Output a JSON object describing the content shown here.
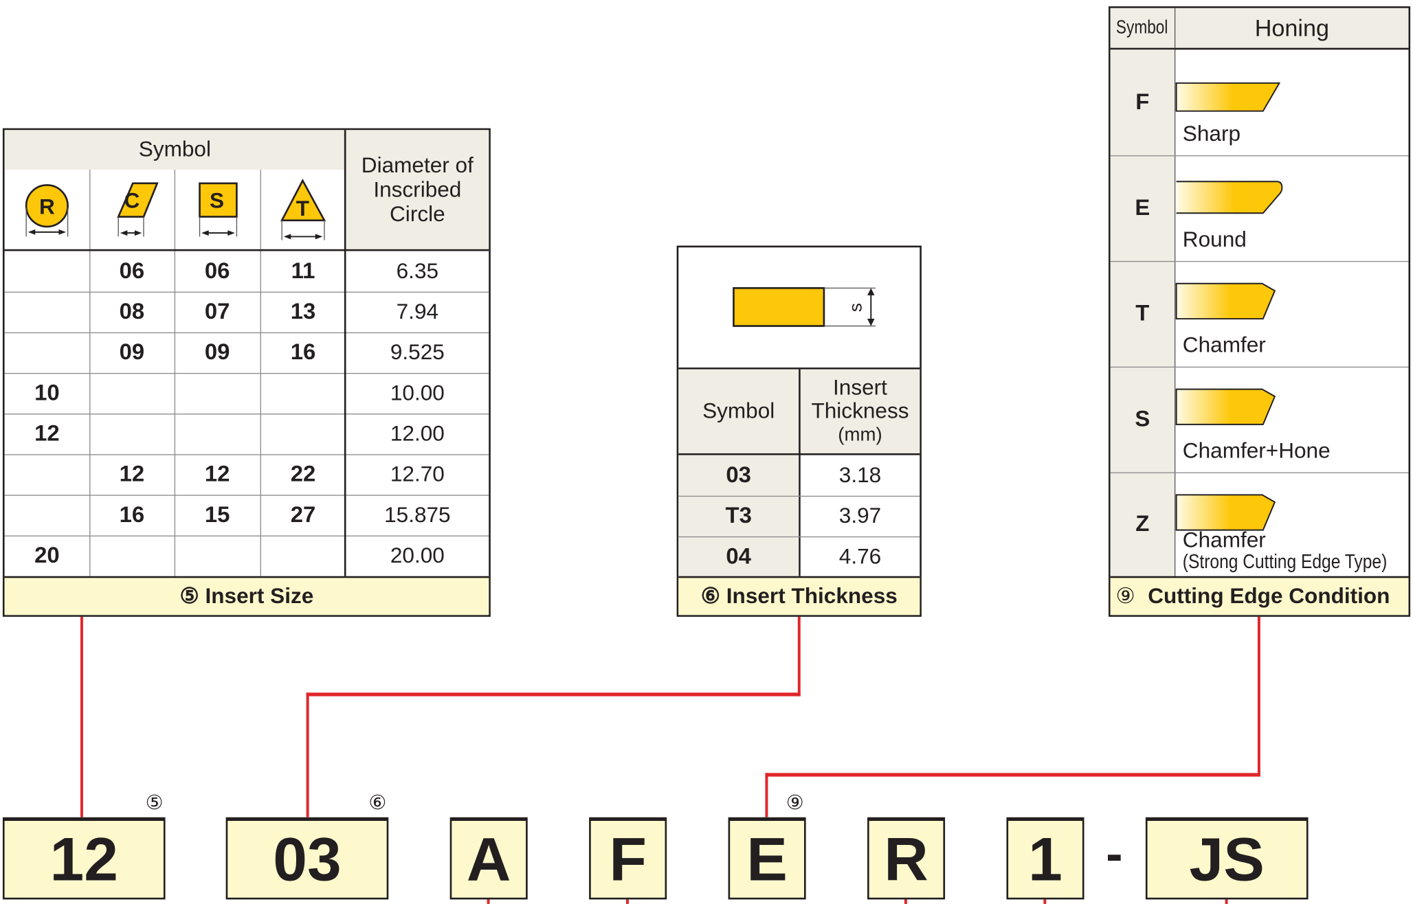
{
  "insert_size": {
    "symbol_header": "Symbol",
    "diameter_header": "Diameter of Inscribed Circle",
    "shapes": [
      {
        "letter": "R",
        "icon": "round-insert-icon"
      },
      {
        "letter": "C",
        "icon": "rhombic-insert-icon"
      },
      {
        "letter": "S",
        "icon": "square-insert-icon"
      },
      {
        "letter": "T",
        "icon": "triangle-insert-icon"
      }
    ],
    "rows": [
      [
        "",
        "06",
        "06",
        "11",
        "6.35"
      ],
      [
        "",
        "08",
        "07",
        "13",
        "7.94"
      ],
      [
        "",
        "09",
        "09",
        "16",
        "9.525"
      ],
      [
        "10",
        "",
        "",
        "",
        "10.00"
      ],
      [
        "12",
        "",
        "",
        "",
        "12.00"
      ],
      [
        "",
        "12",
        "12",
        "22",
        "12.70"
      ],
      [
        "",
        "16",
        "15",
        "27",
        "15.875"
      ],
      [
        "20",
        "",
        "",
        "",
        "20.00"
      ]
    ],
    "footer": "⑤ Insert Size"
  },
  "insert_thickness": {
    "dimension_label": "s",
    "symbol_header": "Symbol",
    "thickness_header": "Insert Thickness",
    "unit": "(mm)",
    "rows": [
      [
        "03",
        "3.18"
      ],
      [
        "T3",
        "3.97"
      ],
      [
        "04",
        "4.76"
      ]
    ],
    "footer": "⑥ Insert Thickness"
  },
  "cutting_edge": {
    "symbol_header": "Symbol",
    "honing_header": "Honing",
    "rows": [
      {
        "symbol": "F",
        "label": "Sharp",
        "sub": "",
        "shape": "sharp"
      },
      {
        "symbol": "E",
        "label": "Round",
        "sub": "",
        "shape": "round"
      },
      {
        "symbol": "T",
        "label": "Chamfer",
        "sub": "",
        "shape": "chamfer"
      },
      {
        "symbol": "S",
        "label": "Chamfer+Hone",
        "sub": "",
        "shape": "chamfer"
      },
      {
        "symbol": "Z",
        "label": "Chamfer",
        "sub": "(Strong Cutting Edge Type)",
        "shape": "chamfer"
      }
    ],
    "footer_num": "⑨",
    "footer": "Cutting Edge Condition"
  },
  "code": {
    "parts": [
      "12",
      "03",
      "A",
      "F",
      "E",
      "R",
      "1",
      "JS"
    ],
    "separator": "-",
    "markers": [
      "⑤",
      "⑥",
      "⑨"
    ]
  },
  "colors": {
    "accent": "#fdc70a",
    "line": "#e0262b",
    "header": "#f0ede4",
    "footer": "#fdf9cc"
  }
}
